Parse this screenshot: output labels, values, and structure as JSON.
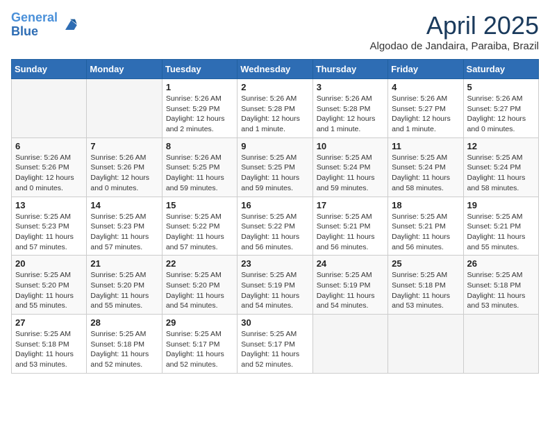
{
  "logo": {
    "line1": "General",
    "line2": "Blue"
  },
  "title": "April 2025",
  "subtitle": "Algodao de Jandaira, Paraiba, Brazil",
  "weekdays": [
    "Sunday",
    "Monday",
    "Tuesday",
    "Wednesday",
    "Thursday",
    "Friday",
    "Saturday"
  ],
  "weeks": [
    [
      {
        "day": null
      },
      {
        "day": null
      },
      {
        "day": "1",
        "sunrise": "5:26 AM",
        "sunset": "5:29 PM",
        "daylight": "12 hours and 2 minutes."
      },
      {
        "day": "2",
        "sunrise": "5:26 AM",
        "sunset": "5:28 PM",
        "daylight": "12 hours and 1 minute."
      },
      {
        "day": "3",
        "sunrise": "5:26 AM",
        "sunset": "5:28 PM",
        "daylight": "12 hours and 1 minute."
      },
      {
        "day": "4",
        "sunrise": "5:26 AM",
        "sunset": "5:27 PM",
        "daylight": "12 hours and 1 minute."
      },
      {
        "day": "5",
        "sunrise": "5:26 AM",
        "sunset": "5:27 PM",
        "daylight": "12 hours and 0 minutes."
      }
    ],
    [
      {
        "day": "6",
        "sunrise": "5:26 AM",
        "sunset": "5:26 PM",
        "daylight": "12 hours and 0 minutes."
      },
      {
        "day": "7",
        "sunrise": "5:26 AM",
        "sunset": "5:26 PM",
        "daylight": "12 hours and 0 minutes."
      },
      {
        "day": "8",
        "sunrise": "5:26 AM",
        "sunset": "5:25 PM",
        "daylight": "11 hours and 59 minutes."
      },
      {
        "day": "9",
        "sunrise": "5:25 AM",
        "sunset": "5:25 PM",
        "daylight": "11 hours and 59 minutes."
      },
      {
        "day": "10",
        "sunrise": "5:25 AM",
        "sunset": "5:24 PM",
        "daylight": "11 hours and 59 minutes."
      },
      {
        "day": "11",
        "sunrise": "5:25 AM",
        "sunset": "5:24 PM",
        "daylight": "11 hours and 58 minutes."
      },
      {
        "day": "12",
        "sunrise": "5:25 AM",
        "sunset": "5:24 PM",
        "daylight": "11 hours and 58 minutes."
      }
    ],
    [
      {
        "day": "13",
        "sunrise": "5:25 AM",
        "sunset": "5:23 PM",
        "daylight": "11 hours and 57 minutes."
      },
      {
        "day": "14",
        "sunrise": "5:25 AM",
        "sunset": "5:23 PM",
        "daylight": "11 hours and 57 minutes."
      },
      {
        "day": "15",
        "sunrise": "5:25 AM",
        "sunset": "5:22 PM",
        "daylight": "11 hours and 57 minutes."
      },
      {
        "day": "16",
        "sunrise": "5:25 AM",
        "sunset": "5:22 PM",
        "daylight": "11 hours and 56 minutes."
      },
      {
        "day": "17",
        "sunrise": "5:25 AM",
        "sunset": "5:21 PM",
        "daylight": "11 hours and 56 minutes."
      },
      {
        "day": "18",
        "sunrise": "5:25 AM",
        "sunset": "5:21 PM",
        "daylight": "11 hours and 56 minutes."
      },
      {
        "day": "19",
        "sunrise": "5:25 AM",
        "sunset": "5:21 PM",
        "daylight": "11 hours and 55 minutes."
      }
    ],
    [
      {
        "day": "20",
        "sunrise": "5:25 AM",
        "sunset": "5:20 PM",
        "daylight": "11 hours and 55 minutes."
      },
      {
        "day": "21",
        "sunrise": "5:25 AM",
        "sunset": "5:20 PM",
        "daylight": "11 hours and 55 minutes."
      },
      {
        "day": "22",
        "sunrise": "5:25 AM",
        "sunset": "5:20 PM",
        "daylight": "11 hours and 54 minutes."
      },
      {
        "day": "23",
        "sunrise": "5:25 AM",
        "sunset": "5:19 PM",
        "daylight": "11 hours and 54 minutes."
      },
      {
        "day": "24",
        "sunrise": "5:25 AM",
        "sunset": "5:19 PM",
        "daylight": "11 hours and 54 minutes."
      },
      {
        "day": "25",
        "sunrise": "5:25 AM",
        "sunset": "5:18 PM",
        "daylight": "11 hours and 53 minutes."
      },
      {
        "day": "26",
        "sunrise": "5:25 AM",
        "sunset": "5:18 PM",
        "daylight": "11 hours and 53 minutes."
      }
    ],
    [
      {
        "day": "27",
        "sunrise": "5:25 AM",
        "sunset": "5:18 PM",
        "daylight": "11 hours and 53 minutes."
      },
      {
        "day": "28",
        "sunrise": "5:25 AM",
        "sunset": "5:18 PM",
        "daylight": "11 hours and 52 minutes."
      },
      {
        "day": "29",
        "sunrise": "5:25 AM",
        "sunset": "5:17 PM",
        "daylight": "11 hours and 52 minutes."
      },
      {
        "day": "30",
        "sunrise": "5:25 AM",
        "sunset": "5:17 PM",
        "daylight": "11 hours and 52 minutes."
      },
      {
        "day": null
      },
      {
        "day": null
      },
      {
        "day": null
      }
    ]
  ]
}
